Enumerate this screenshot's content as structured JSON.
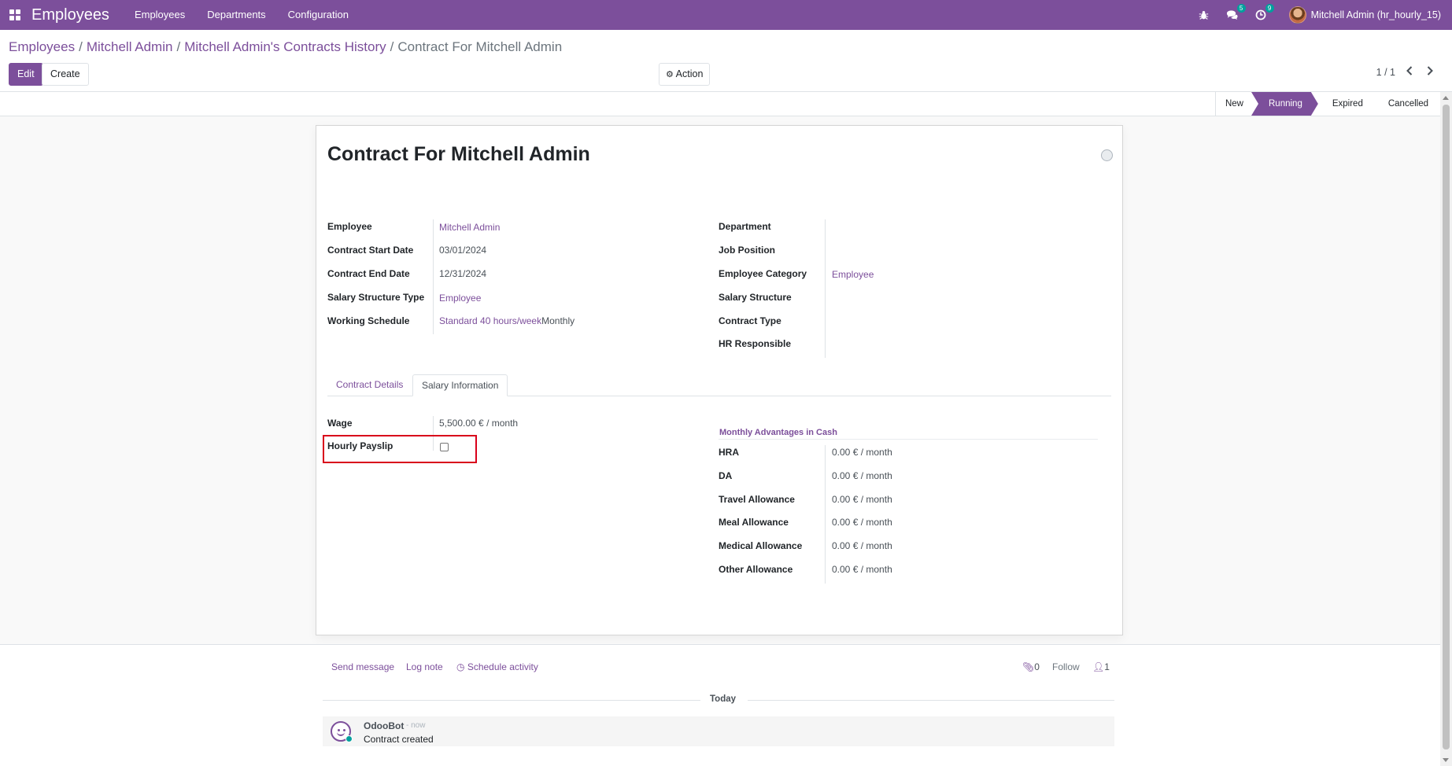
{
  "navbar": {
    "app_title": "Employees",
    "menu": [
      "Employees",
      "Departments",
      "Configuration"
    ],
    "messages_badge": "5",
    "activities_badge": "9",
    "user_name": "Mitchell Admin (hr_hourly_15)",
    "color": "#7c4f9b"
  },
  "breadcrumb": {
    "items": [
      "Employees",
      "Mitchell Admin",
      "Mitchell Admin's Contracts History"
    ],
    "current": "Contract For Mitchell Admin",
    "sep": "/"
  },
  "toolbar": {
    "edit_label": "Edit",
    "create_label": "Create",
    "action_label": "Action",
    "pager": "1 / 1"
  },
  "statusbar": {
    "stages": [
      "New",
      "Running",
      "Expired",
      "Cancelled"
    ],
    "active": "Running"
  },
  "form": {
    "title": "Contract For Mitchell Admin",
    "left": [
      {
        "label": "Employee",
        "value": "Mitchell Admin"
      },
      {
        "label": "Contract Start Date",
        "value": "03/01/2024"
      },
      {
        "label": "Contract End Date",
        "value": "12/31/2024"
      },
      {
        "label": "Salary Structure Type",
        "value": "Employee"
      },
      {
        "label": "Working Schedule",
        "value": "Standard 40 hours/week",
        "extra": "Monthly"
      }
    ],
    "right": [
      {
        "label": "Department",
        "value": ""
      },
      {
        "label": "Job Position",
        "value": ""
      },
      {
        "label": "Employee Category",
        "value": "Employee"
      },
      {
        "label": "Salary Structure",
        "value": ""
      },
      {
        "label": "Contract Type",
        "value": ""
      },
      {
        "label": "HR Responsible",
        "value": ""
      }
    ],
    "tabs": [
      "Contract Details",
      "Salary Information"
    ],
    "active_tab": "Salary Information",
    "salary": {
      "wage_label": "Wage",
      "wage_value": "5,500.00 €",
      "wage_unit": "/ month",
      "hourly_label": "Hourly Payslip",
      "hourly_checked": false
    },
    "advantages": {
      "title": "Monthly Advantages in Cash",
      "items": [
        {
          "label": "HRA",
          "value": "0.00 €",
          "unit": "/ month"
        },
        {
          "label": "DA",
          "value": "0.00 €",
          "unit": "/ month"
        },
        {
          "label": "Travel Allowance",
          "value": "0.00 €",
          "unit": "/ month"
        },
        {
          "label": "Meal Allowance",
          "value": "0.00 €",
          "unit": "/ month"
        },
        {
          "label": "Medical Allowance",
          "value": "0.00 €",
          "unit": "/ month"
        },
        {
          "label": "Other Allowance",
          "value": "0.00 €",
          "unit": "/ month"
        }
      ]
    }
  },
  "chatter": {
    "send_message": "Send message",
    "log_note": "Log note",
    "schedule_activity": "Schedule activity",
    "attachments_count": "0",
    "follow": "Follow",
    "followers_count": "1",
    "today": "Today",
    "message": {
      "author": "OdooBot",
      "date": "- now",
      "body": "Contract created"
    }
  }
}
